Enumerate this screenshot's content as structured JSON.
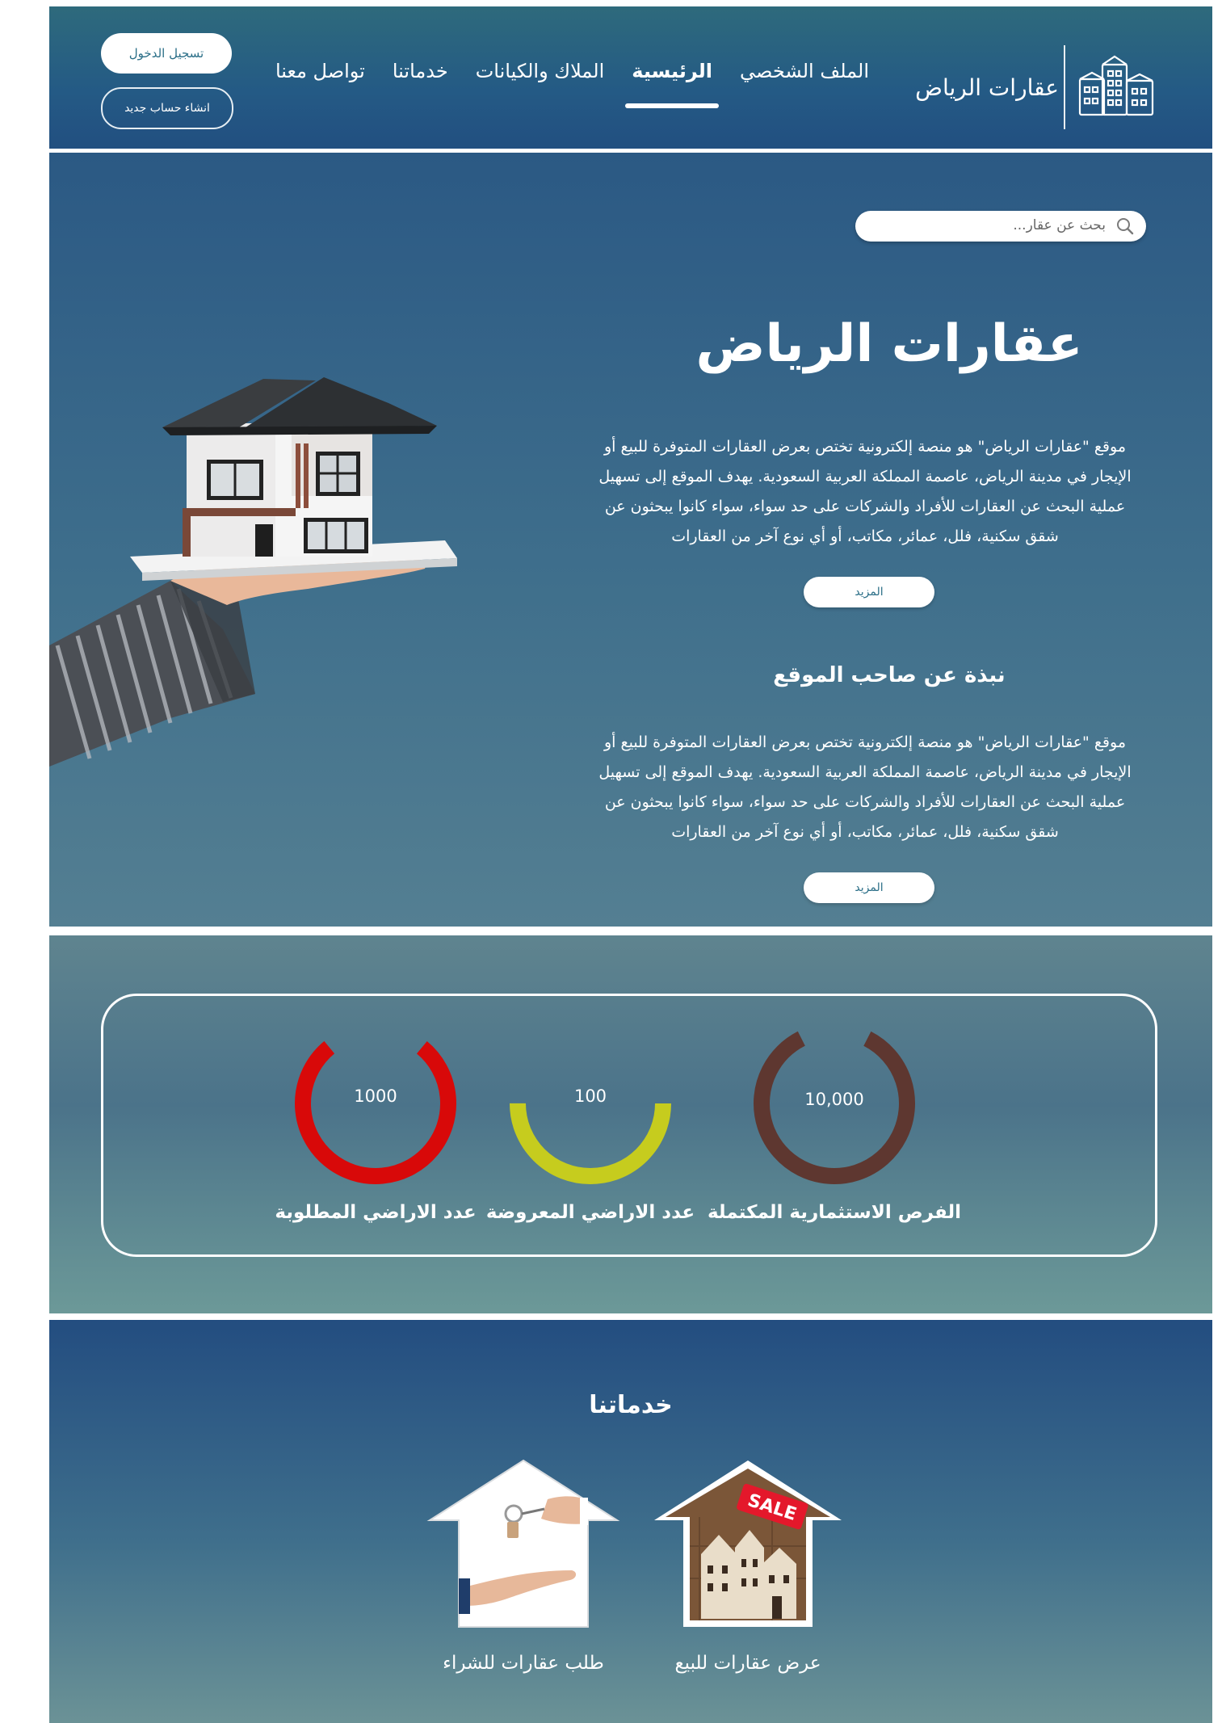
{
  "header": {
    "brand_title": "عقارات الرياض",
    "nav": [
      {
        "label": "الملف الشخصي"
      },
      {
        "label": "الرئيسية",
        "active": true
      },
      {
        "label": "الملاك والكيانات"
      },
      {
        "label": "خدماتنا"
      },
      {
        "label": "تواصل معنا"
      }
    ],
    "login_label": "تسجيل الدخول",
    "register_label": "انشاء حساب جديد"
  },
  "hero": {
    "search_placeholder": "بحث عن عقار...",
    "title": "عقارات الرياض",
    "paragraph_lines": [
      "موقع \"عقارات الرياض\" هو منصة إلكترونية تختص بعرض العقارات المتوفرة للبيع أو",
      "الإيجار في مدينة الرياض، عاصمة المملكة العربية السعودية. يهدف الموقع إلى تسهيل",
      "عملية البحث عن العقارات للأفراد والشركات على حد سواء، سواء كانوا يبحثون عن",
      "شقق سكنية، فلل، عمائر، مكاتب، أو أي نوع آخر من العقارات"
    ],
    "more_label": "المزيد",
    "about_title": "نبذة عن صاحب الموقع",
    "about_lines": [
      "موقع \"عقارات الرياض\" هو منصة إلكترونية تختص بعرض العقارات المتوفرة للبيع أو",
      "الإيجار في مدينة الرياض، عاصمة المملكة العربية السعودية. يهدف الموقع إلى تسهيل",
      "عملية البحث عن العقارات للأفراد والشركات على حد سواء، سواء كانوا يبحثون عن",
      "شقق سكنية، فلل، عمائر، مكاتب، أو أي نوع آخر من العقارات"
    ],
    "about_more_label": "المزيد"
  },
  "stats": [
    {
      "value": "10,000",
      "label": "الفرص الاستثمارية المكتملة",
      "color": "#5e3730",
      "fraction": 0.85
    },
    {
      "value": "100",
      "label": "عدد الاراضي المعروضة",
      "color": "#c6cc1e",
      "fraction": 0.5
    },
    {
      "value": "1000",
      "label": "عدد الاراضي المطلوبة",
      "color": "#d80909",
      "fraction": 0.78
    }
  ],
  "services": {
    "title": "خدماتنا",
    "items": [
      {
        "label": "عرض عقارات للبيع",
        "image_text": "SALE"
      },
      {
        "label": "طلب عقارات للشراء"
      }
    ]
  },
  "colors": {
    "header_bg": "#245a85",
    "accent_text": "#2a6e87",
    "ring_brown": "#5e3730",
    "ring_yellow": "#c6cc1e",
    "ring_red": "#d80909"
  }
}
